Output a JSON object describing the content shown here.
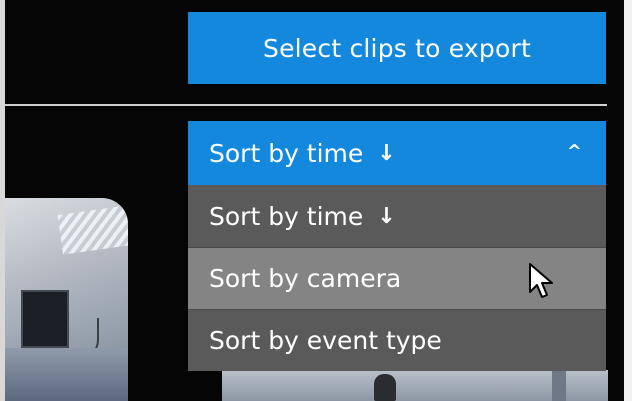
{
  "export": {
    "label": "Select clips to export"
  },
  "sort": {
    "current_label": "Sort by time",
    "current_arrow": "↓",
    "chevron": "^",
    "options": [
      {
        "label": "Sort by time",
        "arrow": "↓"
      },
      {
        "label": "Sort by camera"
      },
      {
        "label": "Sort by event type"
      }
    ],
    "hovered_option": "Sort by camera"
  },
  "colors": {
    "accent": "#1388dc",
    "menu_bg": "#5a5a5a",
    "menu_hover_bg": "#848484",
    "background": "#050505"
  },
  "icons": {
    "sort_direction": "arrow-down-icon",
    "collapse": "chevron-up-icon",
    "pointer": "mouse-cursor-icon"
  }
}
